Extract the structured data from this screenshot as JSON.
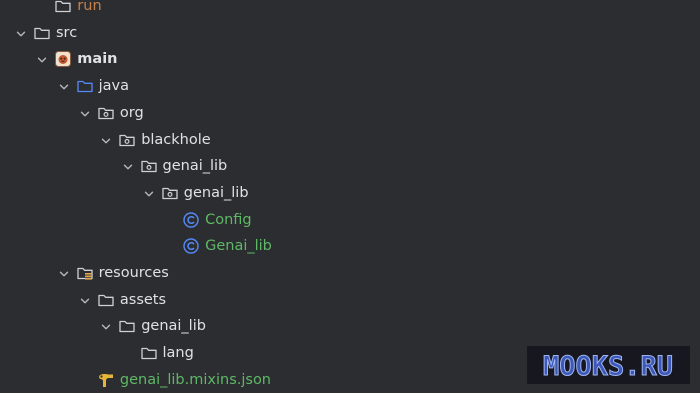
{
  "colors": {
    "background": "#2b2d30",
    "text": "#dfe1e5",
    "class_text": "#5fb865",
    "excluded_text": "#c5824f",
    "folder_icon": "#cfd1d6",
    "source_folder_icon": "#548af7",
    "class_icon": "#548af7",
    "chevron": "#b4b8bf",
    "watermark_fill": "#3c58b8"
  },
  "tree": [
    {
      "label": "run",
      "level": 1,
      "icon": "folder-icon",
      "style": "orange",
      "expandable": false
    },
    {
      "label": "src",
      "level": 0,
      "icon": "folder-icon",
      "style": "normal",
      "expandable": true
    },
    {
      "label": "main",
      "level": 1,
      "icon": "module-icon",
      "style": "bold",
      "expandable": true
    },
    {
      "label": "java",
      "level": 2,
      "icon": "source-folder-icon",
      "style": "normal",
      "expandable": true
    },
    {
      "label": "org",
      "level": 3,
      "icon": "package-icon",
      "style": "normal",
      "expandable": true
    },
    {
      "label": "blackhole",
      "level": 4,
      "icon": "package-icon",
      "style": "normal",
      "expandable": true
    },
    {
      "label": "genai_lib",
      "level": 5,
      "icon": "package-icon",
      "style": "normal",
      "expandable": true
    },
    {
      "label": "genai_lib",
      "level": 6,
      "icon": "package-icon",
      "style": "normal",
      "expandable": true
    },
    {
      "label": "Config",
      "level": 7,
      "icon": "class-icon",
      "style": "green",
      "expandable": false
    },
    {
      "label": "Genai_lib",
      "level": 7,
      "icon": "class-icon",
      "style": "green",
      "expandable": false
    },
    {
      "label": "resources",
      "level": 2,
      "icon": "resources-folder-icon",
      "style": "normal",
      "expandable": true
    },
    {
      "label": "assets",
      "level": 3,
      "icon": "folder-icon",
      "style": "normal",
      "expandable": true
    },
    {
      "label": "genai_lib",
      "level": 4,
      "icon": "folder-icon",
      "style": "normal",
      "expandable": true
    },
    {
      "label": "lang",
      "level": 5,
      "icon": "folder-icon",
      "style": "normal",
      "expandable": false
    },
    {
      "label": "genai_lib.mixins.json",
      "level": 3,
      "icon": "json-file-icon",
      "style": "green",
      "expandable": false
    }
  ],
  "watermark": "MOOKS.RU"
}
